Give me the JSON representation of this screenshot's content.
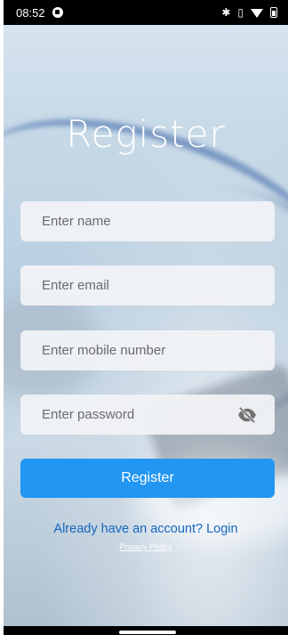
{
  "status_bar": {
    "time": "08:52",
    "icons": [
      "data-saver-icon",
      "bluetooth-icon",
      "vibrate-icon",
      "wifi-icon",
      "battery-icon"
    ]
  },
  "page": {
    "title": "Register"
  },
  "form": {
    "name_placeholder": "Enter name",
    "email_placeholder": "Enter email",
    "mobile_placeholder": "Enter mobile number",
    "password_placeholder": "Enter password",
    "password_toggle_icon": "visibility-off-icon",
    "submit_label": "Register"
  },
  "links": {
    "login_text": "Already have an account? Login",
    "privacy_text": "Privacy Policy"
  },
  "colors": {
    "primary": "#2196f3",
    "link": "#1565c0",
    "field_bg": "#f0f2f6"
  }
}
